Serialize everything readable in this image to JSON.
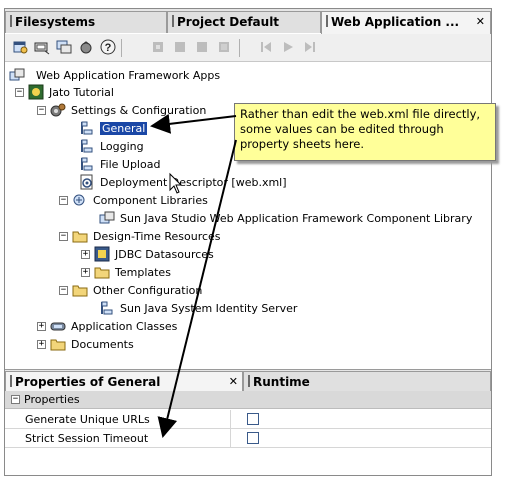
{
  "tabs": [
    {
      "label": "Filesystems"
    },
    {
      "label": "Project Default"
    },
    {
      "label": "Web Application ..."
    }
  ],
  "tab_close": "✕",
  "toolbar": {
    "buttons": [
      "new-wizard-icon",
      "component-icon",
      "page-icon",
      "bean-icon",
      "help-icon",
      "disabled-1-icon",
      "disabled-2-icon",
      "disabled-3-icon",
      "disabled-4-icon",
      "step-back-icon",
      "play-icon",
      "step-forward-icon"
    ]
  },
  "tree": {
    "root": "Web Application Framework Apps",
    "project": "Jato Tutorial",
    "settings": "Settings & Configuration",
    "general": "General",
    "logging": "Logging",
    "fileupload": "File Upload",
    "deployment": "Deployment Descriptor [web.xml]",
    "complibs": "Component Libraries",
    "complib_item": "Sun Java Studio Web Application Framework Component Library",
    "designtime": "Design-Time Resources",
    "jdbc": "JDBC Datasources",
    "templates": "Templates",
    "otherconfig": "Other Configuration",
    "identity": "Sun Java System Identity Server",
    "appclasses": "Application Classes",
    "documents": "Documents",
    "expand_minus": "−",
    "expand_plus": "+"
  },
  "callout": {
    "text": "Rather than edit the web.xml file directly, some values can be edited through property sheets here."
  },
  "bottom": {
    "tabs": [
      {
        "label": "Properties of General"
      },
      {
        "label": "Runtime"
      }
    ],
    "close": "✕",
    "section": "Properties",
    "section_toggle": "−",
    "rows": [
      {
        "name": "Generate Unique URLs",
        "checked": false
      },
      {
        "name": "Strict Session Timeout",
        "checked": false
      }
    ]
  }
}
